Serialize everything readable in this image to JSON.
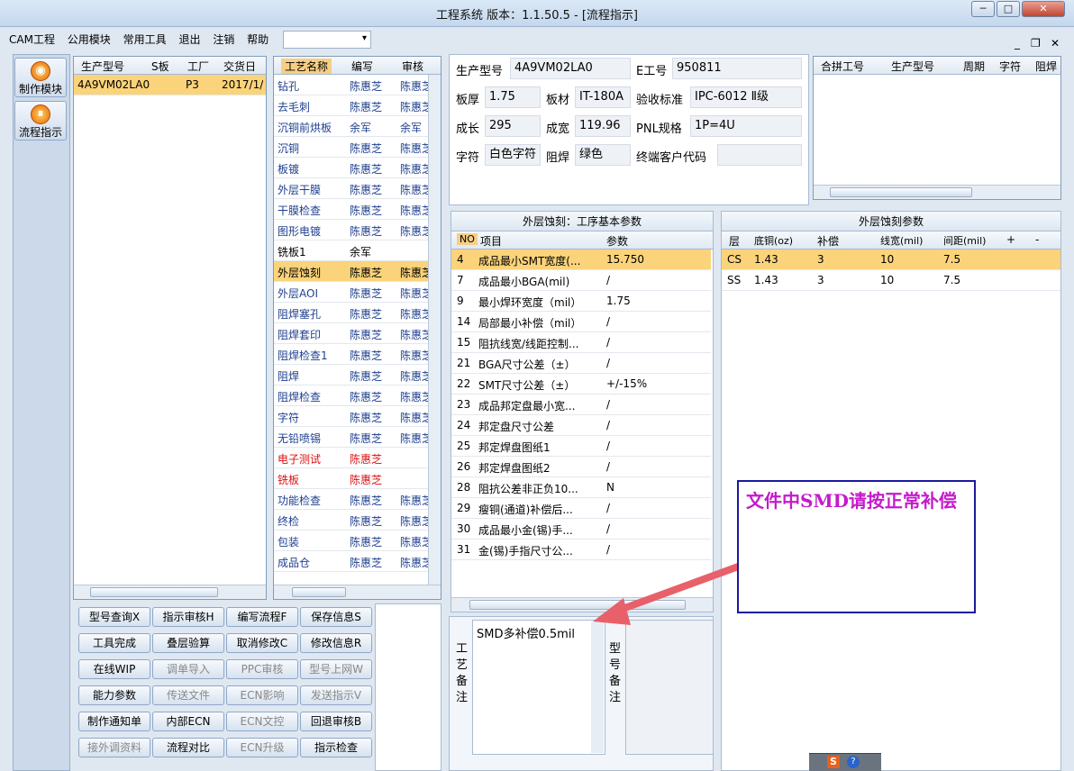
{
  "window": {
    "title": "工程系统  版本：1.1.50.5 - [流程指示]",
    "btn_min": "─",
    "btn_max": "□",
    "btn_close": "✕"
  },
  "menu": {
    "items": [
      "CAM工程",
      "公用模块",
      "常用工具",
      "退出",
      "注销",
      "帮助"
    ],
    "combo_value": ""
  },
  "mdi": {
    "min": "_",
    "restore": "❐",
    "close": "✕"
  },
  "sidebar": {
    "items": [
      {
        "label": "制作模块",
        "icon": "make-module-icon"
      },
      {
        "label": "流程指示",
        "icon": "process-icon"
      }
    ]
  },
  "job_grid": {
    "headers": [
      "生产型号",
      "S板",
      "工厂",
      "交货日期"
    ],
    "rows": [
      [
        "4A9VM02LA0",
        "",
        "P3",
        "2017/1/"
      ]
    ]
  },
  "process_grid": {
    "headers": [
      "工艺名称",
      "编写",
      "审核"
    ],
    "rows": [
      {
        "name": "钻孔",
        "writer": "陈惠芝",
        "reviewer": "陈惠芝",
        "style": "blue"
      },
      {
        "name": "去毛刺",
        "writer": "陈惠芝",
        "reviewer": "陈惠芝",
        "style": "blue"
      },
      {
        "name": "沉铜前烘板",
        "writer": "余军",
        "reviewer": "余军",
        "style": "blue"
      },
      {
        "name": "沉铜",
        "writer": "陈惠芝",
        "reviewer": "陈惠芝",
        "style": "blue"
      },
      {
        "name": "板镀",
        "writer": "陈惠芝",
        "reviewer": "陈惠芝",
        "style": "blue"
      },
      {
        "name": "外层干膜",
        "writer": "陈惠芝",
        "reviewer": "陈惠芝",
        "style": "blue"
      },
      {
        "name": "干膜检查",
        "writer": "陈惠芝",
        "reviewer": "陈惠芝",
        "style": "blue"
      },
      {
        "name": "图形电镀",
        "writer": "陈惠芝",
        "reviewer": "陈惠芝",
        "style": "blue"
      },
      {
        "name": "铣板1",
        "writer": "余军",
        "reviewer": "",
        "style": "black"
      },
      {
        "name": "外层蚀刻",
        "writer": "陈惠芝",
        "reviewer": "陈惠芝",
        "style": "selected"
      },
      {
        "name": "外层AOI",
        "writer": "陈惠芝",
        "reviewer": "陈惠芝",
        "style": "blue"
      },
      {
        "name": "阻焊塞孔",
        "writer": "陈惠芝",
        "reviewer": "陈惠芝",
        "style": "blue"
      },
      {
        "name": "阻焊套印",
        "writer": "陈惠芝",
        "reviewer": "陈惠芝",
        "style": "blue"
      },
      {
        "name": "阻焊检查1",
        "writer": "陈惠芝",
        "reviewer": "陈惠芝",
        "style": "blue"
      },
      {
        "name": "阻焊",
        "writer": "陈惠芝",
        "reviewer": "陈惠芝",
        "style": "blue"
      },
      {
        "name": "阻焊检查",
        "writer": "陈惠芝",
        "reviewer": "陈惠芝",
        "style": "blue"
      },
      {
        "name": "字符",
        "writer": "陈惠芝",
        "reviewer": "陈惠芝",
        "style": "blue"
      },
      {
        "name": "无铅喷锡",
        "writer": "陈惠芝",
        "reviewer": "陈惠芝",
        "style": "blue"
      },
      {
        "name": "电子测试",
        "writer": "陈惠芝",
        "reviewer": "",
        "style": "red"
      },
      {
        "name": "铣板",
        "writer": "陈惠芝",
        "reviewer": "",
        "style": "red"
      },
      {
        "name": "功能检查",
        "writer": "陈惠芝",
        "reviewer": "陈惠芝",
        "style": "blue"
      },
      {
        "name": "终检",
        "writer": "陈惠芝",
        "reviewer": "陈惠芝",
        "style": "blue"
      },
      {
        "name": "包装",
        "writer": "陈惠芝",
        "reviewer": "陈惠芝",
        "style": "blue"
      },
      {
        "name": "成品仓",
        "writer": "陈惠芝",
        "reviewer": "陈惠芝",
        "style": "blue"
      }
    ]
  },
  "buttons": [
    [
      "型号查询X",
      "指示审核H",
      "编写流程F",
      "保存信息S"
    ],
    [
      "工具完成",
      "叠层验算",
      "取消修改C",
      "修改信息R"
    ],
    [
      "在线WIP",
      "调单导入",
      "PPC审核",
      "型号上网W"
    ],
    [
      "能力参数",
      "传送文件",
      "ECN影响",
      "发送指示V"
    ],
    [
      "制作通知单",
      "内部ECN",
      "ECN文控",
      "回退审核B"
    ],
    [
      "接外调资料",
      "流程对比",
      "ECN升级",
      "指示检查"
    ]
  ],
  "buttons_disabled": [
    [
      false,
      false,
      false,
      false
    ],
    [
      false,
      false,
      false,
      false
    ],
    [
      false,
      true,
      true,
      true
    ],
    [
      false,
      true,
      true,
      true
    ],
    [
      false,
      false,
      true,
      false
    ],
    [
      true,
      false,
      true,
      false
    ]
  ],
  "info": {
    "prod_model_label": "生产型号",
    "prod_model": "4A9VM02LA0",
    "eno_label": "E工号",
    "eno": "950811",
    "thick_label": "板厚",
    "thick": "1.75",
    "material_label": "板材",
    "material": "IT-180A",
    "standard_label": "验收标准",
    "standard": "IPC-6012 Ⅱ级",
    "len_label": "成长",
    "len": "295",
    "width_label": "成宽",
    "width": "119.96",
    "pnl_label": "PNL规格",
    "pnl": "1P=4U",
    "char_label": "字符",
    "char": "白色字符",
    "mask_label": "阻焊",
    "mask": "绿色",
    "customer_label": "终端客户代码",
    "customer": ""
  },
  "merge_grid": {
    "headers": [
      "合拼工号",
      "生产型号",
      "周期",
      "字符",
      "阻焊"
    ]
  },
  "params": {
    "caption": "外层蚀刻：工序基本参数",
    "headers": [
      "NO",
      "项目",
      "参数"
    ],
    "rows": [
      [
        "4",
        "成品最小SMT宽度(...",
        "15.750"
      ],
      [
        "7",
        "成品最小BGA(mil)",
        "/"
      ],
      [
        "9",
        "最小焊环宽度（mil）",
        "1.75"
      ],
      [
        "14",
        "局部最小补偿（mil）",
        "/"
      ],
      [
        "15",
        "阻抗线宽/线距控制...",
        "/"
      ],
      [
        "21",
        "BGA尺寸公差（±）",
        "/"
      ],
      [
        "22",
        "SMT尺寸公差（±）",
        "+/-15%"
      ],
      [
        "23",
        "成品邦定盘最小宽...",
        "/"
      ],
      [
        "24",
        "邦定盘尺寸公差",
        "/"
      ],
      [
        "25",
        "邦定焊盘图纸1",
        "/"
      ],
      [
        "26",
        "邦定焊盘图纸2",
        "/"
      ],
      [
        "28",
        "阻抗公差非正负10...",
        "N"
      ],
      [
        "29",
        "瘦铜(通道)补偿后...",
        "/"
      ],
      [
        "30",
        "成品最小金(锡)手...",
        "/"
      ],
      [
        "31",
        "金(锡)手指尺寸公...",
        "/"
      ]
    ]
  },
  "etch": {
    "caption": "外层蚀刻参数",
    "headers": [
      "层",
      "底铜(oz)",
      "补偿",
      "线宽(mil)",
      "间距(mil)",
      "+",
      "-"
    ],
    "rows": [
      [
        "CS",
        "1.43",
        "3",
        "10",
        "7.5"
      ],
      [
        "SS",
        "1.43",
        "3",
        "10",
        "7.5"
      ]
    ]
  },
  "remarks": {
    "process_label": "工艺备注",
    "process_text": "SMD多补偿0.5mil",
    "model_label": "型号备注",
    "model_text": ""
  },
  "annotation": {
    "text": "文件中SMD请按正常补偿"
  },
  "colors": {
    "accent_note": "#c41bcb",
    "arrow": "#e8606a",
    "selected_row": "#fbd37a"
  }
}
